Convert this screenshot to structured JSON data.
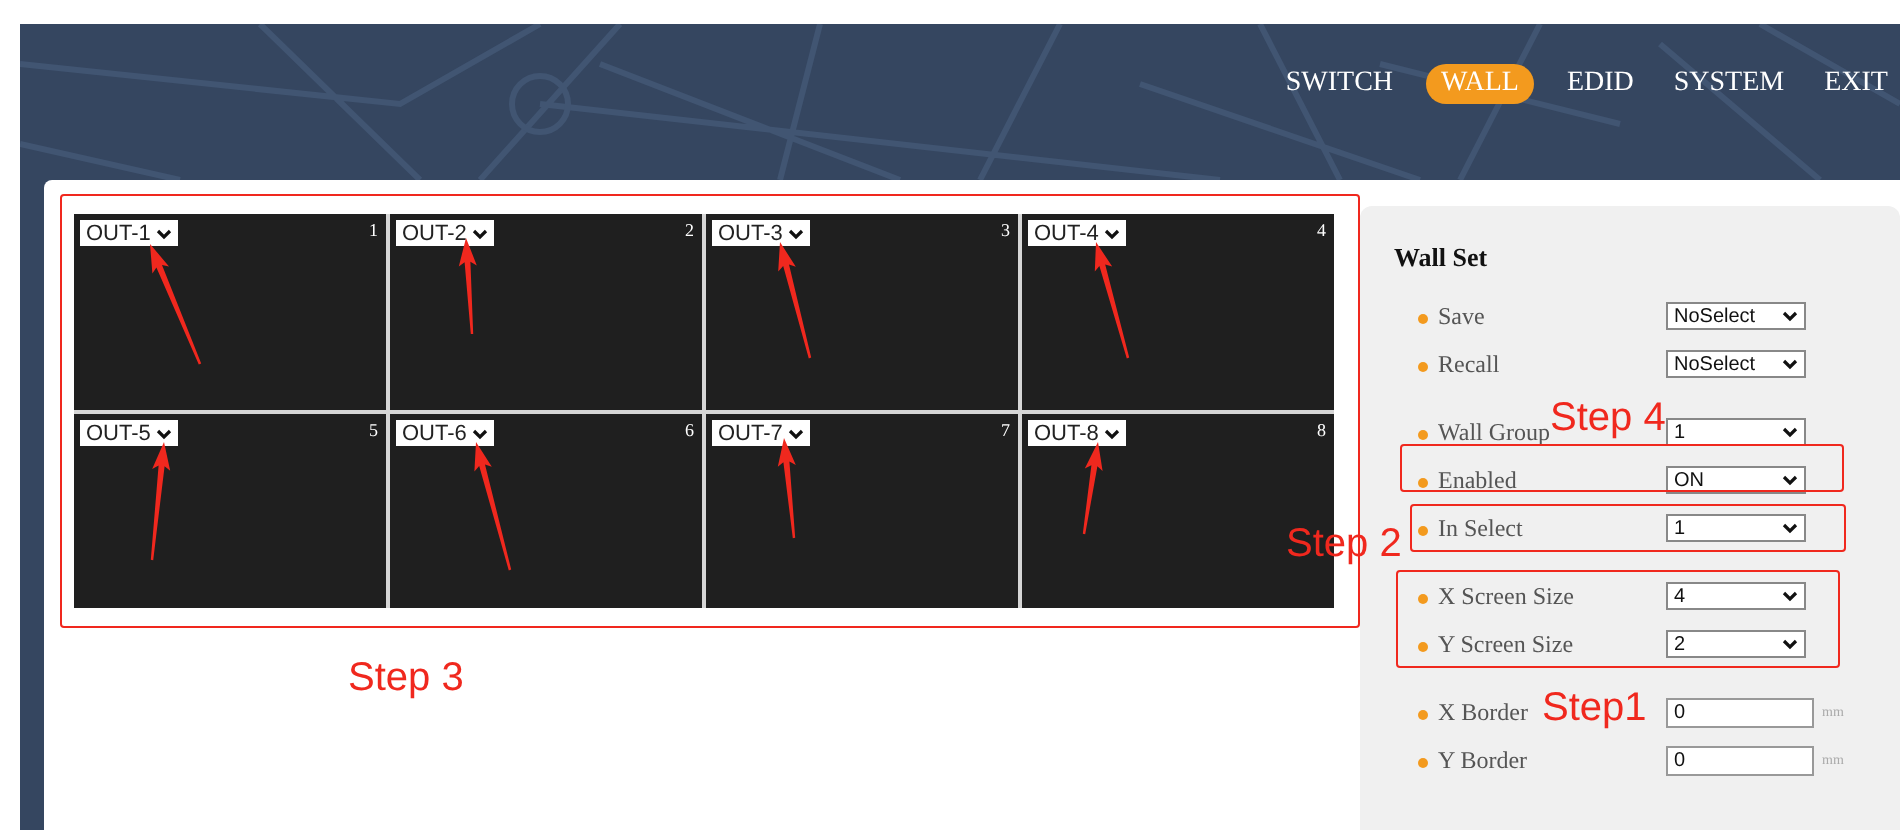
{
  "nav": [
    {
      "label": "SWITCH",
      "selected": false
    },
    {
      "label": "WALL",
      "selected": true
    },
    {
      "label": "EDID",
      "selected": false
    },
    {
      "label": "SYSTEM",
      "selected": false
    },
    {
      "label": "EXIT",
      "selected": false
    }
  ],
  "wall": {
    "outputs": [
      {
        "value": "OUT-1",
        "number": "1"
      },
      {
        "value": "OUT-2",
        "number": "2"
      },
      {
        "value": "OUT-3",
        "number": "3"
      },
      {
        "value": "OUT-4",
        "number": "4"
      },
      {
        "value": "OUT-5",
        "number": "5"
      },
      {
        "value": "OUT-6",
        "number": "6"
      },
      {
        "value": "OUT-7",
        "number": "7"
      },
      {
        "value": "OUT-8",
        "number": "8"
      }
    ]
  },
  "wall_set": {
    "title": "Wall Set",
    "groups": [
      {
        "rows": [
          {
            "kind": "select",
            "label": "Save",
            "value": "NoSelect"
          },
          {
            "kind": "select",
            "label": "Recall",
            "value": "NoSelect"
          }
        ]
      },
      {
        "rows": [
          {
            "kind": "select",
            "label": "Wall Group",
            "value": "1"
          },
          {
            "kind": "select",
            "label": "Enabled",
            "value": "ON"
          },
          {
            "kind": "select",
            "label": "In Select",
            "value": "1"
          }
        ]
      },
      {
        "rows": [
          {
            "kind": "select",
            "label": "X Screen Size",
            "value": "4"
          },
          {
            "kind": "select",
            "label": "Y Screen Size",
            "value": "2"
          }
        ]
      },
      {
        "rows": [
          {
            "kind": "input",
            "label": "X Border",
            "value": "0",
            "unit": "mm"
          },
          {
            "kind": "input",
            "label": "Y Border",
            "value": "0",
            "unit": "mm"
          }
        ]
      }
    ]
  },
  "annotations": [
    "Step 3",
    "Step 4",
    "Step 2",
    "Step1"
  ]
}
